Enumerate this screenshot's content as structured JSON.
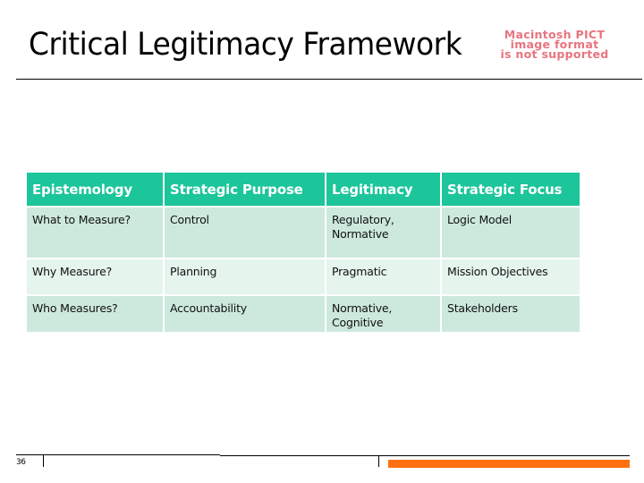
{
  "slide": {
    "title": "Critical Legitimacy Framework",
    "image_placeholder": {
      "line1": "Macintosh PICT",
      "line2": "image format",
      "line3": "is not supported"
    },
    "page_number": "36",
    "accent_color": "#ff7010",
    "header_color": "#1cc59a"
  },
  "table": {
    "headers": [
      "Epistemology",
      "Strategic Purpose",
      "Legitimacy",
      "Strategic Focus"
    ],
    "rows": [
      [
        "What to Measure?",
        "Control",
        "Regulatory, Normative",
        "Logic Model"
      ],
      [
        "Why Measure?",
        "Planning",
        "Pragmatic",
        "Mission Objectives"
      ],
      [
        "Who Measures?",
        "Accountability",
        "Normative, Cognitive",
        "Stakeholders"
      ]
    ]
  }
}
